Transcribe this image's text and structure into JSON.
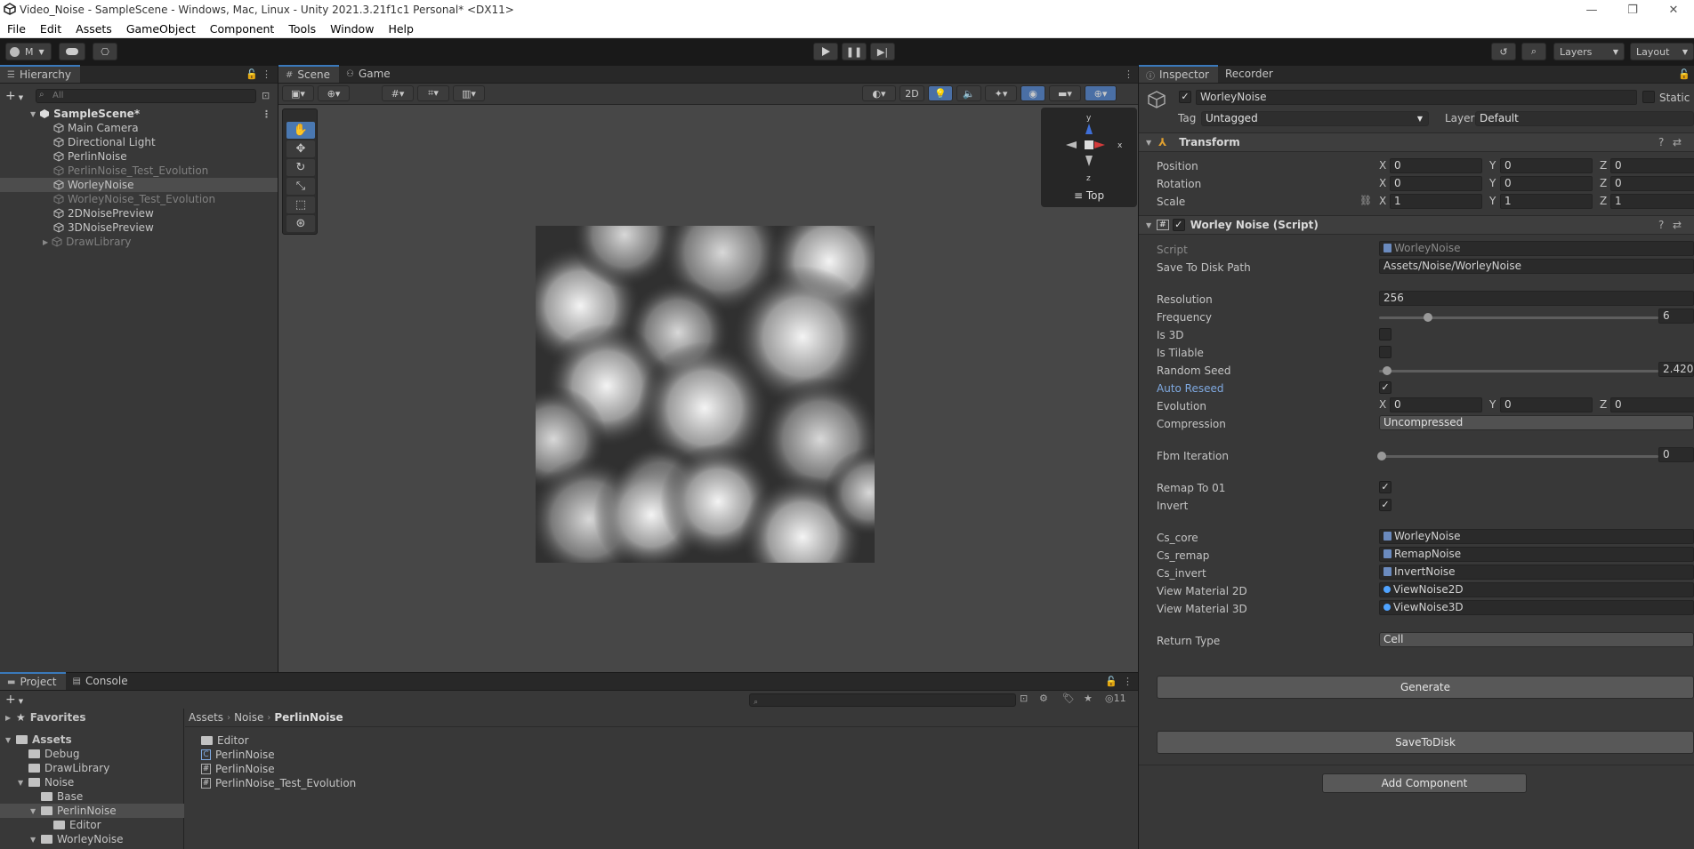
{
  "window": {
    "title": "Video_Noise - SampleScene - Windows, Mac, Linux - Unity 2021.3.21f1c1 Personal* <DX11>",
    "controls": [
      "—",
      "❐",
      "✕"
    ]
  },
  "menu": [
    "File",
    "Edit",
    "Assets",
    "GameObject",
    "Component",
    "Tools",
    "Window",
    "Help"
  ],
  "toolbar": {
    "account": "M",
    "layers_label": "Layers",
    "layout_label": "Layout"
  },
  "hierarchy": {
    "tab": "Hierarchy",
    "search_placeholder": "All",
    "scene": "SampleScene*",
    "items": [
      {
        "label": "Main Camera",
        "disabled": false
      },
      {
        "label": "Directional Light",
        "disabled": false
      },
      {
        "label": "PerlinNoise",
        "disabled": false
      },
      {
        "label": "PerlinNoise_Test_Evolution",
        "disabled": true
      },
      {
        "label": "WorleyNoise",
        "disabled": false,
        "selected": true
      },
      {
        "label": "WorleyNoise_Test_Evolution",
        "disabled": true
      },
      {
        "label": "2DNoisePreview",
        "disabled": false
      },
      {
        "label": "3DNoisePreview",
        "disabled": false
      },
      {
        "label": "DrawLibrary",
        "disabled": true
      }
    ]
  },
  "scene_view": {
    "tabs": [
      "Scene",
      "Game"
    ],
    "mode_2d": "2D",
    "gizmo_label": "Top",
    "axes": {
      "y": "y",
      "x": "x",
      "z": "z"
    }
  },
  "inspector": {
    "tabs": [
      "Inspector",
      "Recorder"
    ],
    "object_name": "WorleyNoise",
    "static_label": "Static",
    "tag_label": "Tag",
    "tag_value": "Untagged",
    "layer_label": "Layer",
    "layer_value": "Default",
    "transform": {
      "title": "Transform",
      "position_label": "Position",
      "rotation_label": "Rotation",
      "scale_label": "Scale",
      "position": [
        "0",
        "0",
        "0"
      ],
      "rotation": [
        "0",
        "0",
        "0"
      ],
      "scale": [
        "1",
        "1",
        "1"
      ]
    },
    "script_component": {
      "title": "Worley Noise (Script)",
      "fields": {
        "script_label": "Script",
        "script_value": "WorleyNoise",
        "save_path_label": "Save To Disk Path",
        "save_path_value": "Assets/Noise/WorleyNoise",
        "resolution_label": "Resolution",
        "resolution_value": "256",
        "frequency_label": "Frequency",
        "frequency_value": "6",
        "is3d_label": "Is 3D",
        "is_tilable_label": "Is Tilable",
        "random_seed_label": "Random Seed",
        "random_seed_value": "2.420",
        "auto_reseed_label": "Auto Reseed",
        "evolution_label": "Evolution",
        "evolution": [
          "0",
          "0",
          "0"
        ],
        "compression_label": "Compression",
        "compression_value": "Uncompressed",
        "fbm_label": "Fbm Iteration",
        "fbm_value": "0",
        "remap_label": "Remap To 01",
        "invert_label": "Invert",
        "cs_core_label": "Cs_core",
        "cs_core_value": "WorleyNoise",
        "cs_remap_label": "Cs_remap",
        "cs_remap_value": "RemapNoise",
        "cs_invert_label": "Cs_invert",
        "cs_invert_value": "InvertNoise",
        "viewmat2d_label": "View Material 2D",
        "viewmat2d_value": "ViewNoise2D",
        "viewmat3d_label": "View Material 3D",
        "viewmat3d_value": "ViewNoise3D",
        "return_type_label": "Return Type",
        "return_type_value": "Cell"
      },
      "frequency_fraction": 0.17,
      "random_seed_fraction": 0.02,
      "fbm_fraction": 0.0
    },
    "generate_button": "Generate",
    "save_button": "SaveToDisk",
    "add_component_button": "Add Component",
    "axis_labels": [
      "X",
      "Y",
      "Z"
    ]
  },
  "project": {
    "tabs": [
      "Project",
      "Console"
    ],
    "hidden_count": "11",
    "breadcrumb": [
      "Assets",
      "Noise",
      "PerlinNoise"
    ],
    "tree": [
      {
        "label": "Favorites",
        "level": 0,
        "bold": true
      },
      {
        "label": "Assets",
        "level": 0,
        "bold": true
      },
      {
        "label": "Debug",
        "level": 1
      },
      {
        "label": "DrawLibrary",
        "level": 1
      },
      {
        "label": "Noise",
        "level": 1
      },
      {
        "label": "Base",
        "level": 2
      },
      {
        "label": "PerlinNoise",
        "level": 2,
        "selected": true
      },
      {
        "label": "Editor",
        "level": 3
      },
      {
        "label": "WorleyNoise",
        "level": 2
      }
    ],
    "files": [
      {
        "label": "Editor",
        "type": "folder"
      },
      {
        "label": "PerlinNoise",
        "type": "cs"
      },
      {
        "label": "PerlinNoise",
        "type": "script"
      },
      {
        "label": "PerlinNoise_Test_Evolution",
        "type": "script"
      }
    ]
  },
  "colors": {
    "accent": "#3a79bb",
    "link_blue": "#7fa9e0",
    "panel_bg": "#383838",
    "scene_bg": "#474747"
  }
}
